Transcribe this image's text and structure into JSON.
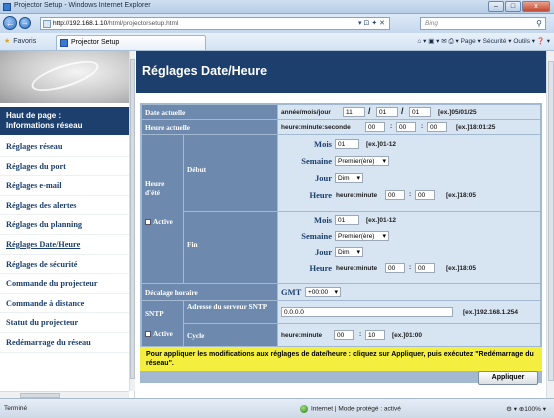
{
  "window": {
    "title": "Projector Setup - Windows Internet Explorer",
    "min": "–",
    "max": "□",
    "close": "x"
  },
  "address": {
    "host": "http://192.168.1.10",
    "path": "/html/projectorsetup.html",
    "tools": "▾ ⊡ ✦ ✕"
  },
  "search": {
    "placeholder": "Bing"
  },
  "favorites": {
    "label": "Favoris",
    "tab": "Projector Setup"
  },
  "commands": {
    "text": "⌂ ▾ ▣ ▾ ✉ ⎙ ▾  Page ▾  Sécurité ▾  Outils ▾  ❓ ▾"
  },
  "sidebar": {
    "header": "Haut de page :\nInformations réseau",
    "items": [
      {
        "label": "Réglages réseau"
      },
      {
        "label": "Réglages du port"
      },
      {
        "label": "Réglages e-mail"
      },
      {
        "label": "Réglages des alertes"
      },
      {
        "label": "Réglages du planning"
      },
      {
        "label": "Réglages Date/Heure",
        "active": true
      },
      {
        "label": "Réglages de sécurité"
      },
      {
        "label": "Commande du projecteur"
      },
      {
        "label": "Commande à distance"
      },
      {
        "label": "Statut du projecteur"
      },
      {
        "label": "Redémarrage du réseau"
      }
    ]
  },
  "page": {
    "title": "Réglages Date/Heure"
  },
  "form": {
    "date": {
      "label": "Date actuelle",
      "format": "année/mois/jour",
      "year": "11",
      "month": "01",
      "day": "01",
      "example": "[ex.]05/01/25",
      "sep": "/"
    },
    "time": {
      "label": "Heure actuelle",
      "format": "heure:minute:seconde",
      "h": "00",
      "m": "00",
      "s": "00",
      "example": "[ex.]18:01:25",
      "sep": ":"
    },
    "dst": {
      "label": "Heure\nd'été",
      "active": "Active",
      "start": {
        "label": "Début",
        "mois_label": "Mois",
        "mois": "01",
        "mois_ex": "[ex.]01-12",
        "semaine_label": "Semaine",
        "semaine": "Premier(ère)",
        "jour_label": "Jour",
        "jour": "Dim",
        "heure_label": "Heure",
        "heure_fmt": "heure:minute",
        "h": "00",
        "m": "00",
        "heure_ex": "[ex.]18:05"
      },
      "end": {
        "label": "Fin",
        "mois_label": "Mois",
        "mois": "01",
        "mois_ex": "[ex.]01-12",
        "semaine_label": "Semaine",
        "semaine": "Premier(ère)",
        "jour_label": "Jour",
        "jour": "Dim",
        "heure_label": "Heure",
        "heure_fmt": "heure:minute",
        "h": "00",
        "m": "00",
        "heure_ex": "[ex.]18:05"
      }
    },
    "offset": {
      "label": "Décalage horaire",
      "gmt": "GMT",
      "value": "+00:00"
    },
    "sntp": {
      "label": "SNTP",
      "active": "Active",
      "server_label": "Adresse du serveur SNTP",
      "server": "0.0.0.0",
      "server_ex": "[ex.]192.168.1.254",
      "cycle_label": "Cycle",
      "cycle_fmt": "heure:minute",
      "h": "00",
      "m": "10",
      "cycle_ex": "[ex.]01:00"
    }
  },
  "note": "Pour appliquer les modifications aux réglages de date/heure : cliquez sur Appliquer, puis exécutez \"Redémarrage du réseau\".",
  "apply_button": "Appliquer",
  "status": {
    "text": "Terminé",
    "zone": "Internet | Mode protégé : activé",
    "zoom": "⚙ ▾  ⊕100% ▾"
  }
}
